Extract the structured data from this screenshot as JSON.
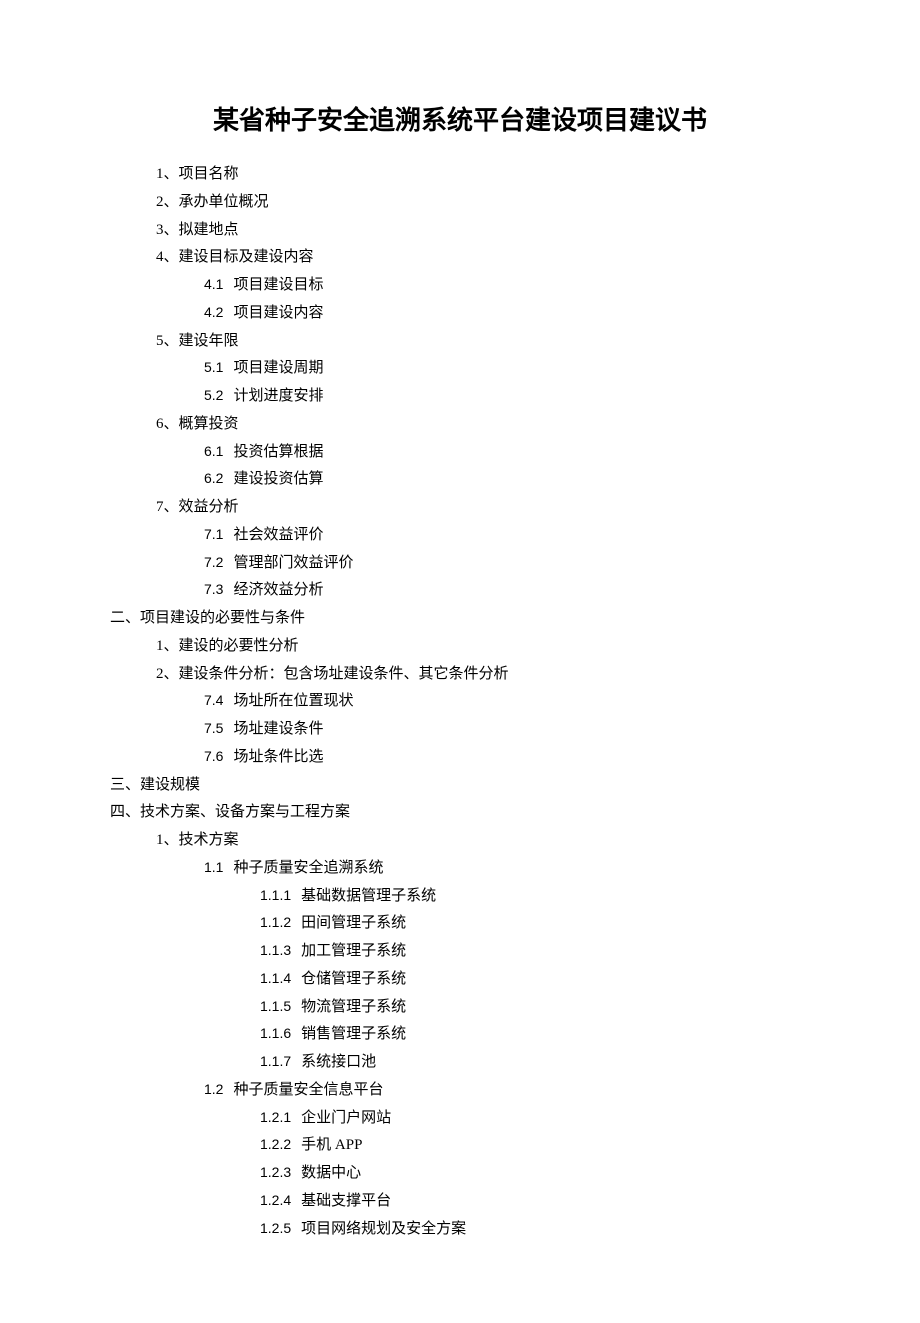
{
  "title": "某省种子安全追溯系统平台建设项目建议书",
  "sec1": {
    "i1": "1、项目名称",
    "i2": "2、承办单位概况",
    "i3": "3、拟建地点",
    "i4": "4、建设目标及建设内容",
    "i4_1_num": "4.1",
    "i4_1_txt": "项目建设目标",
    "i4_2_num": "4.2",
    "i4_2_txt": "项目建设内容",
    "i5": "5、建设年限",
    "i5_1_num": "5.1",
    "i5_1_txt": "项目建设周期",
    "i5_2_num": "5.2",
    "i5_2_txt": "计划进度安排",
    "i6": "6、概算投资",
    "i6_1_num": "6.1",
    "i6_1_txt": "投资估算根据",
    "i6_2_num": "6.2",
    "i6_2_txt": "建设投资估算",
    "i7": "7、效益分析",
    "i7_1_num": "7.1",
    "i7_1_txt": "社会效益评价",
    "i7_2_num": "7.2",
    "i7_2_txt": "管理部门效益评价",
    "i7_3_num": "7.3",
    "i7_3_txt": "经济效益分析"
  },
  "sec2": {
    "head": "二、项目建设的必要性与条件",
    "i1": "1、建设的必要性分析",
    "i2": "2、建设条件分析：包含场址建设条件、其它条件分析",
    "i2_1_num": "7.4",
    "i2_1_txt": "场址所在位置现状",
    "i2_2_num": "7.5",
    "i2_2_txt": "场址建设条件",
    "i2_3_num": "7.6",
    "i2_3_txt": "场址条件比选"
  },
  "sec3": {
    "head": "三、建设规模"
  },
  "sec4": {
    "head": "四、技术方案、设备方案与工程方案",
    "i1": "1、技术方案",
    "i1_1_num": "1.1",
    "i1_1_txt": "种子质量安全追溯系统",
    "i1_1_1_num": "1.1.1",
    "i1_1_1_txt": "基础数据管理子系统",
    "i1_1_2_num": "1.1.2",
    "i1_1_2_txt": "田间管理子系统",
    "i1_1_3_num": "1.1.3",
    "i1_1_3_txt": "加工管理子系统",
    "i1_1_4_num": "1.1.4",
    "i1_1_4_txt": "仓储管理子系统",
    "i1_1_5_num": "1.1.5",
    "i1_1_5_txt": "物流管理子系统",
    "i1_1_6_num": "1.1.6",
    "i1_1_6_txt": "销售管理子系统",
    "i1_1_7_num": "1.1.7",
    "i1_1_7_txt": "系统接口池",
    "i1_2_num": "1.2",
    "i1_2_txt": "种子质量安全信息平台",
    "i1_2_1_num": "1.2.1",
    "i1_2_1_txt": "企业门户网站",
    "i1_2_2_num": "1.2.2",
    "i1_2_2_txt": "手机 APP",
    "i1_2_3_num": "1.2.3",
    "i1_2_3_txt": "数据中心",
    "i1_2_4_num": "1.2.4",
    "i1_2_4_txt": "基础支撑平台",
    "i1_2_5_num": "1.2.5",
    "i1_2_5_txt": "项目网络规划及安全方案"
  }
}
